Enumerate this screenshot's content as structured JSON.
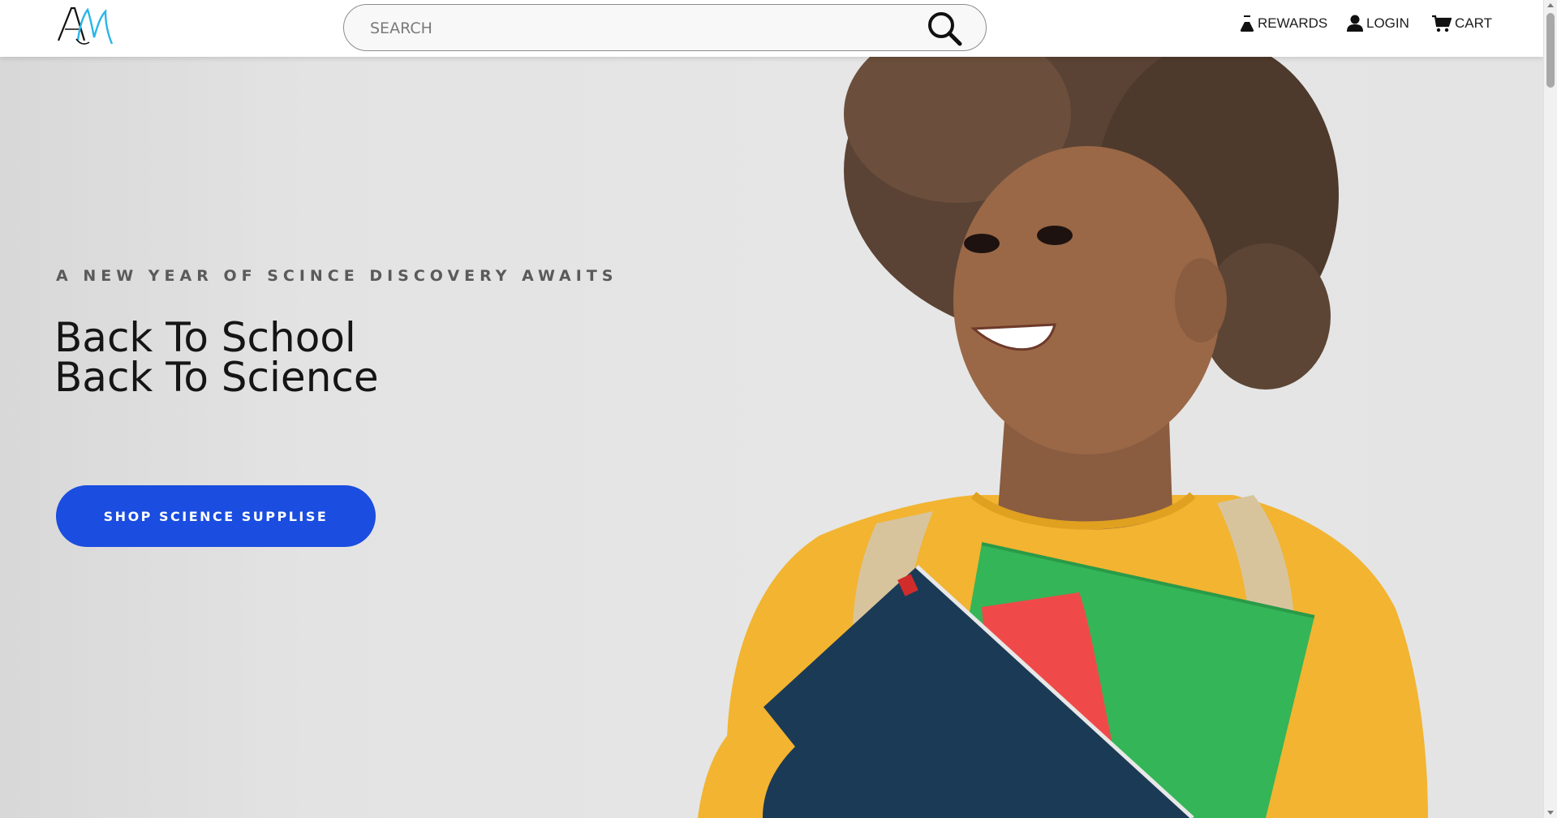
{
  "header": {
    "search": {
      "placeholder": "SEARCH"
    },
    "nav": {
      "rewards_label": "REWARDS",
      "login_label": "LOGIN",
      "cart_label": "CART"
    },
    "logo_letters": "AM"
  },
  "hero": {
    "kicker": "A NEW YEAR OF SCINCE DISCOVERY AWAITS",
    "headline_line1": "Back To School",
    "headline_line2": "Back To Science",
    "cta_label": "SHOP SCIENCE SUPPLISE",
    "image_description_icon": "girl-with-notebooks-photo"
  },
  "colors": {
    "accent": "#1a4de0",
    "logo_blue": "#2ab6e8",
    "text_dark": "#151515",
    "kicker_gray": "#5a5a5a"
  }
}
